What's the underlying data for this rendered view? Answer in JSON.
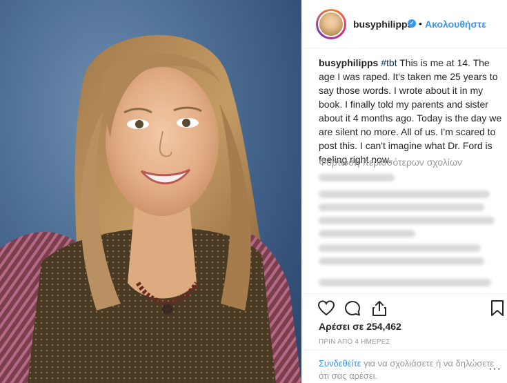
{
  "post": {
    "username": "busyphilipps",
    "verified_glyph": "✓",
    "separator": "•",
    "follow_label": "Ακολουθήστε"
  },
  "caption": {
    "username": "busyphilipps",
    "hashtag": "#tbt",
    "text": " This is me at 14. The age I was raped. It's taken me 25 years to say those words. I wrote about it in my book. I finally told my parents and sister about it 4 months ago. Today is the day we are silent no more. All of us. I'm scared to post this. I can't imagine what Dr. Ford is feeling right now."
  },
  "comments": {
    "load_more": "Φόρτωση περισσότερων σχολίων",
    "blurred_count": 4
  },
  "actions": {
    "icons": [
      "heart-icon",
      "comment-icon",
      "share-icon",
      "bookmark-icon"
    ]
  },
  "likes": {
    "label": "Αρέσει σε 254,462"
  },
  "timestamp": "ΠΡΙΝ ΑΠΟ 4 ΗΜΕΡΕΣ",
  "footer": {
    "login_link": "Συνδεθείτε",
    "login_text": " για να σχολιάσετε ή να δηλώσετε ότι σας αρέσει.",
    "more_glyph": "···"
  },
  "colors": {
    "link_blue": "#3897f0",
    "text": "#262626",
    "muted": "#999999",
    "divider": "#efefef"
  }
}
